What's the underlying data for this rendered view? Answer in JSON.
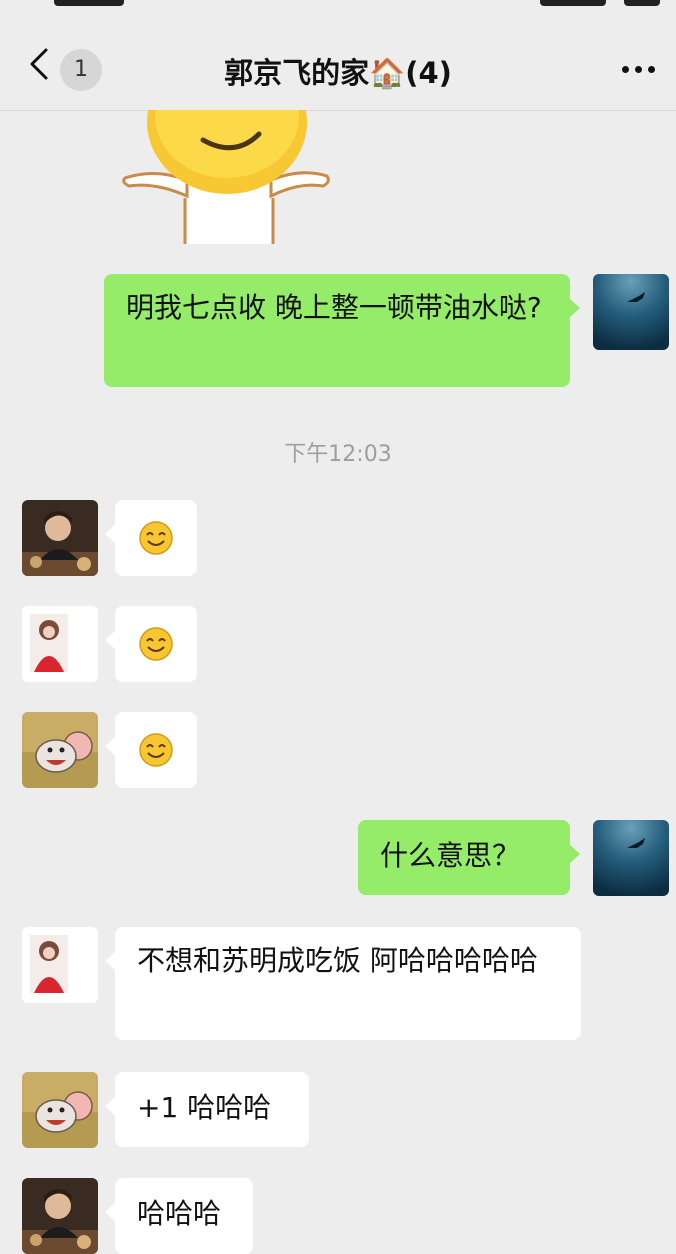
{
  "nav": {
    "unread_count": "1",
    "title": "郭京飞的家🏠(4)"
  },
  "messages": {
    "m1": "明我七点收 晚上整一顿带油水哒?",
    "timestamp": "下午12:03",
    "m5": "什么意思？",
    "m6": "不想和苏明成吃饭 阿哈哈哈哈哈",
    "m7": "+1 哈哈哈",
    "m8": "哈哈哈"
  },
  "emoji": {
    "m2": "smile-emoji",
    "m3": "smile-emoji",
    "m4": "smile-emoji"
  },
  "colors": {
    "background": "#ededed",
    "my_bubble": "#95ec69",
    "their_bubble": "#ffffff"
  }
}
